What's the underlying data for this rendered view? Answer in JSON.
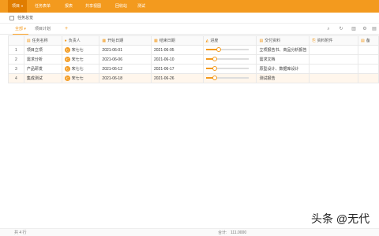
{
  "topbar": {
    "menus": [
      "项目",
      "任务表单",
      "报表",
      "共享视图",
      "回收站",
      "测试"
    ]
  },
  "page": {
    "title": "任务总览"
  },
  "tabs": [
    {
      "label": "全部"
    },
    {
      "label": "项目计划"
    }
  ],
  "table": {
    "headers": [
      "任务名称",
      "负责人",
      "开始日期",
      "结束日期",
      "进度",
      "交付资料",
      "资料附件",
      "备"
    ],
    "rows": [
      {
        "num": "1",
        "task": "项目立项",
        "avatar": "七",
        "owner": "宋七七",
        "start": "2021-06-01",
        "end": "2021-06-05",
        "progress": 0.3,
        "deliverable": "立项报告书、商品分析报告"
      },
      {
        "num": "2",
        "task": "需求分析",
        "avatar": "七",
        "owner": "宋七七",
        "start": "2021-06-06",
        "end": "2021-06-10",
        "progress": 0.22,
        "deliverable": "需求文档"
      },
      {
        "num": "3",
        "task": "产品研发",
        "avatar": "七",
        "owner": "宋七七",
        "start": "2021-06-12",
        "end": "2021-06-17",
        "progress": 0.22,
        "deliverable": "原型设计、数据库设计"
      },
      {
        "num": "4",
        "task": "集成测试",
        "avatar": "七",
        "owner": "宋七七",
        "start": "2021-06-18",
        "end": "2021-06-26",
        "progress": 0.22,
        "deliverable": "测试报告"
      }
    ]
  },
  "statusbar": {
    "count": "共 4 行",
    "sum_label": "合计:",
    "sum_value": "111.0000"
  },
  "watermark": "头条 @无代"
}
